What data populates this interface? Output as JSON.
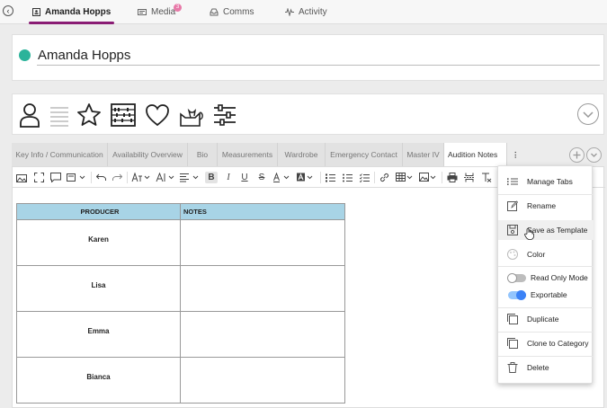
{
  "nav": {
    "tabs": [
      {
        "label": "Amanda Hopps",
        "icon": "profile-icon"
      },
      {
        "label": "Media",
        "icon": "media-icon",
        "badge": "3"
      },
      {
        "label": "Comms",
        "icon": "inbox-icon"
      },
      {
        "label": "Activity",
        "icon": "activity-icon"
      }
    ]
  },
  "header": {
    "name": "Amanda Hopps",
    "status_color": "#2bb39a"
  },
  "categories": {
    "icons": [
      "person-icon",
      "list-icon",
      "star-icon",
      "abacus-icon",
      "heart-icon",
      "cat-icon",
      "sliders-icon"
    ]
  },
  "tabs": {
    "items": [
      "Key Info / Communication",
      "Availability Overview",
      "Bio",
      "Measurements",
      "Wardrobe",
      "Emergency Contact",
      "Master IV",
      "Audition Notes"
    ],
    "active": "Audition Notes"
  },
  "table": {
    "headers": [
      "PRODUCER",
      "NOTES"
    ],
    "rows": [
      [
        "Karen",
        ""
      ],
      [
        "Lisa",
        ""
      ],
      [
        "Emma",
        ""
      ],
      [
        "Bianca",
        ""
      ]
    ],
    "header_color": "#a8d4e6"
  },
  "menu": {
    "items": [
      {
        "label": "Manage Tabs",
        "icon": "list-icon"
      },
      {
        "label": "Rename",
        "icon": "edit-icon"
      },
      {
        "label": "Save as Template",
        "icon": "save-icon"
      },
      {
        "label": "Color",
        "icon": "palette-icon"
      },
      {
        "label": "Read Only Mode",
        "toggle": false
      },
      {
        "label": "Exportable",
        "toggle": true
      },
      {
        "label": "Duplicate",
        "icon": "copy-icon"
      },
      {
        "label": "Clone to Category",
        "icon": "clone-icon"
      },
      {
        "label": "Delete",
        "icon": "trash-icon"
      }
    ],
    "toggle_on_color": "#3b82f6"
  }
}
